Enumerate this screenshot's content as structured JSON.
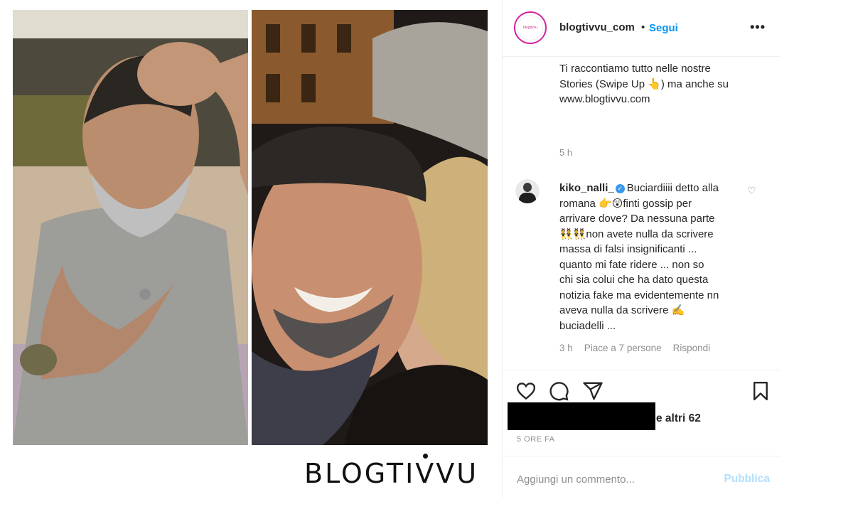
{
  "post": {
    "username": "blogtivvu_com",
    "separator": "•",
    "follow_label": "Segui",
    "more_label": "•••",
    "avatar_text": "blogtivvu",
    "caption_lines": [
      "Ti raccontiamo tutto nelle nostre",
      "Stories (Swipe Up 👆) ma anche su",
      "www.blogtivvu.com"
    ],
    "caption_time": "5 h"
  },
  "comment": {
    "username": "kiko_nalli_",
    "verified_glyph": "✓",
    "lines": [
      "Buciardiiii detto alla",
      "romana 👉😲finti gossip per",
      "arrivare dove? Da nessuna parte",
      "👯👯non avete nulla da scrivere",
      "massa di falsi insignificanti ...",
      "quanto mi fate ridere ... non so",
      "chi sia colui che ha dato questa",
      "notizia fake ma evidentemente nn",
      "aveva nulla da scrivere ✍️",
      "buciadelli ..."
    ],
    "time": "3 h",
    "likes_text": "Piace a 7 persone",
    "reply_label": "Rispondi",
    "like_glyph": "♡"
  },
  "engagement": {
    "likes_suffix": "e altri 62",
    "posted_ago": "5 ORE FA"
  },
  "add_comment": {
    "placeholder": "Aggiungi un commento...",
    "post_label": "Pubblica"
  },
  "watermark": {
    "text": "BLOGTIVVU"
  },
  "colors": {
    "link_blue": "#0095f6",
    "post_disabled": "#b2dffc",
    "muted": "#8e8e8e",
    "text": "#262626",
    "verified": "#3897f0"
  }
}
